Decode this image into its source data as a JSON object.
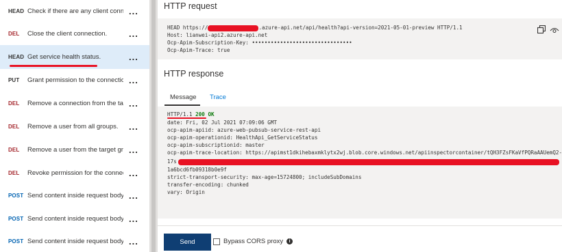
{
  "colors": {
    "selected_bg": "#deecf9",
    "del_method": "#a4262c",
    "post_method": "#0062b1",
    "status_ok": "#107c10",
    "annotation_red": "#e81123",
    "send_button": "#0f3e73"
  },
  "operations": [
    {
      "method": "HEAD",
      "label": "Check if there are any client conn..."
    },
    {
      "method": "DEL",
      "label": "Close the client connection."
    },
    {
      "method": "HEAD",
      "label": "Get service health status."
    },
    {
      "method": "PUT",
      "label": "Grant permission to the connection."
    },
    {
      "method": "DEL",
      "label": "Remove a connection from the tar..."
    },
    {
      "method": "DEL",
      "label": "Remove a user from all groups."
    },
    {
      "method": "DEL",
      "label": "Remove a user from the target gr..."
    },
    {
      "method": "DEL",
      "label": "Revoke permission for the connec..."
    },
    {
      "method": "POST",
      "label": "Send content inside request body ..."
    },
    {
      "method": "POST",
      "label": "Send content inside request body ..."
    },
    {
      "method": "POST",
      "label": "Send content inside request body ..."
    }
  ],
  "more_label": "...",
  "request": {
    "title": "HTTP request",
    "line1_prefix": "HEAD https://",
    "line1_suffix": ".azure-api.net/api/health?api-version=2021-05-01-preview HTTP/1.1",
    "line2": "Host: lianwei-api2.azure-api.net",
    "line3": "Ocp-Apim-Subscription-Key: ••••••••••••••••••••••••••••••••",
    "line4": "Ocp-Apim-Trace: true"
  },
  "response": {
    "title": "HTTP response",
    "tab_message": "Message",
    "tab_trace": "Trace",
    "status_prefix": "HTTP/1.1",
    "status_code": "200 OK",
    "lines": [
      "date: Fri, 02 Jul 2021 07:09:06 GMT",
      "ocp-apim-apiid: azure-web-pubsub-service-rest-api",
      "ocp-apim-operationid: HealthApi_GetServiceStatus",
      "ocp-apim-subscriptionid: master",
      "ocp-apim-trace-location: https://apimst1dkihebaxmklytx2wj.blob.core.windows.net/apiinspectorcontainer/tQH3FZsFKaVfPQRaAAUemQ2-",
      "17s",
      "1a6bcd6fb09318b0e9f",
      "strict-transport-security: max-age=15724800; includeSubDomains",
      "transfer-encoding: chunked",
      "vary: Origin"
    ]
  },
  "footer": {
    "send_label": "Send",
    "cors_label": "Bypass CORS proxy",
    "info_glyph": "i"
  }
}
